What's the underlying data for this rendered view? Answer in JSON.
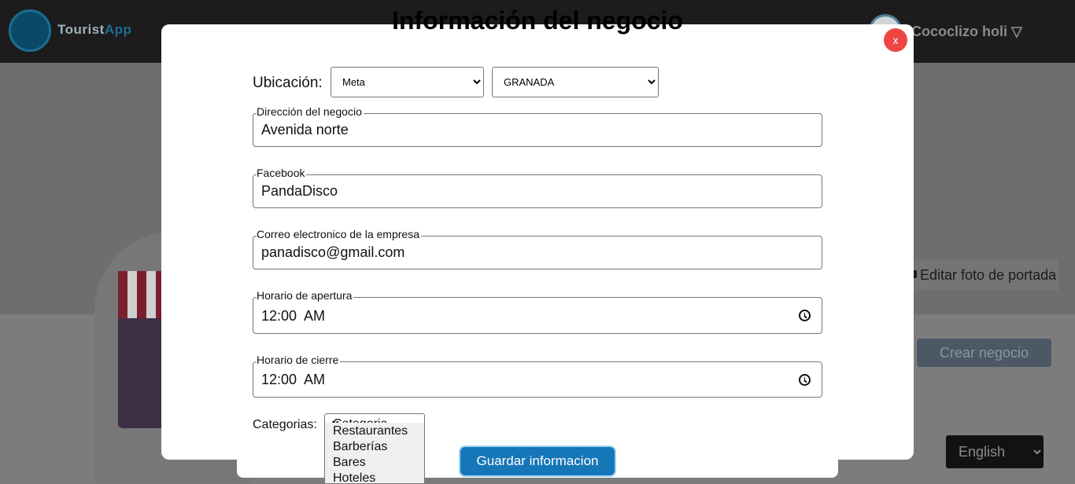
{
  "app": {
    "logo_word_1": "Tourist",
    "logo_word_2": "App",
    "user_name": "Cococlizo holi ▽"
  },
  "page": {
    "edit_cover_label": "Editar foto de portada",
    "create_business_label": "Crear negocio",
    "language": {
      "selected": "English"
    }
  },
  "modal": {
    "title": "Información del negocio",
    "close_label": "x",
    "location": {
      "label": "Ubicación:",
      "department": "Meta",
      "city": "GRANADA"
    },
    "fields": {
      "address": {
        "legend": "Dirección del negocio",
        "value": "Avenida norte"
      },
      "facebook": {
        "legend": "Facebook",
        "value": "PandaDisco"
      },
      "email": {
        "legend": "Correo electronico de la empresa",
        "value": "panadisco@gmail.com"
      },
      "opening": {
        "legend": "Horario de apertura",
        "value": "12:00  AM"
      },
      "closing": {
        "legend": "Horario de cierre",
        "value": "12:00  AM"
      }
    },
    "categories": {
      "label": "Categorias:",
      "selected": "Categoria",
      "options": [
        "Restaurantes",
        "Barberías",
        "Bares",
        "Hoteles"
      ]
    },
    "save_label": "Guardar informacion"
  },
  "colors": {
    "primary": "#1677b8",
    "close": "#f04545",
    "overlay": "#6f6f6f"
  }
}
